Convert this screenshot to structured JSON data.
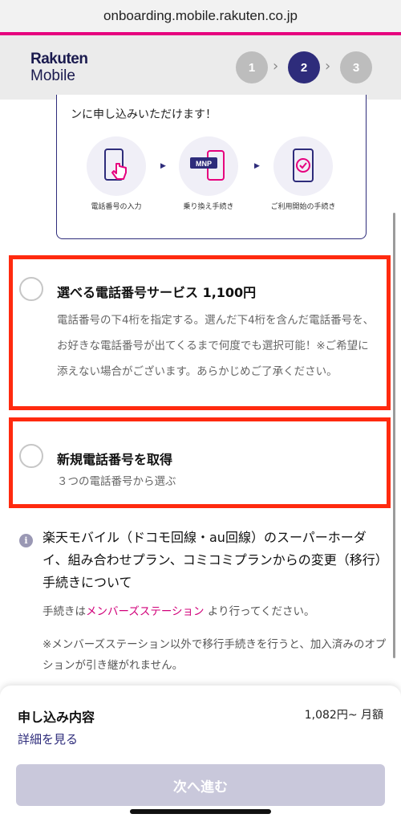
{
  "browser": {
    "url": "onboarding.mobile.rakuten.co.jp"
  },
  "header": {
    "logo_line1": "Rakuten",
    "logo_line2": "Mobile",
    "steps": [
      "1",
      "2",
      "3"
    ],
    "chevron": "›",
    "active_step": 2
  },
  "flow": {
    "text": "ンに申し込みいただけます！",
    "items": [
      {
        "icon": "phone-tap-icon",
        "caption": "電話番号の入力"
      },
      {
        "icon": "mnp-transfer-icon",
        "caption": "乗り換え手続き"
      },
      {
        "icon": "phone-check-icon",
        "caption": "ご利用開始の手続き"
      }
    ],
    "mnp_label": "MNP",
    "arrow": "▶"
  },
  "options": [
    {
      "title": "選べる電話番号サービス 1,100円",
      "description": "電話番号の下4桁を指定する。選んだ下4桁を含んだ電話番号を、お好きな電話番号が出てくるまで何度でも選択可能！※ご希望に添えない場合がございます。あらかじめご了承ください。"
    },
    {
      "title": "新規電話番号を取得",
      "description": "３つの電話番号から選ぶ"
    }
  ],
  "notice": {
    "icon_glyph": "i",
    "title": "楽天モバイル（ドコモ回線・au回線）のスーパーホーダイ、組み合わせプラン、コミコミプランからの変更（移行）手続きについて",
    "p1_prefix": "手続きは",
    "p1_link": "メンバーズステーション",
    "p1_suffix": " より行ってください。",
    "p2": "※メンバーズステーション以外で移行手続きを行うと、加入済みのオプションが引き継がれません。"
  },
  "summary": {
    "label": "申し込み内容",
    "price": "1,082円~ 月額",
    "details_link": "詳細を見る",
    "next_button": "次へ進む"
  },
  "colors": {
    "brand_navy": "#2e2c7b",
    "highlight_red": "#ff2a0f",
    "link_pink": "#d1007a",
    "accent_pink": "#e6007e"
  }
}
